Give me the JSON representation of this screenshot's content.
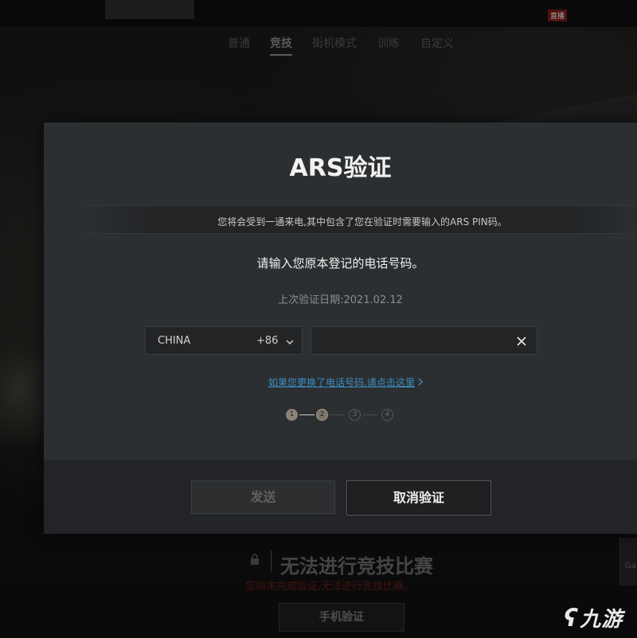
{
  "background": {
    "top_nav": {
      "live_badge": "直播"
    },
    "sub_nav": {
      "tabs": [
        {
          "label": "普通",
          "active": false
        },
        {
          "label": "竞技",
          "active": true
        },
        {
          "label": "街机模式",
          "active": false
        },
        {
          "label": "训练",
          "active": false
        },
        {
          "label": "自定义",
          "active": false
        }
      ]
    },
    "bottom": {
      "lock_icon": "lock-icon",
      "title": "无法进行竞技比赛",
      "subtitle": "您尚未完成验证,无法进行竞技比赛。",
      "phone_verify_label": "手机验证",
      "side_panel_text": "Ga"
    },
    "watermark": "九游"
  },
  "modal": {
    "title": "ARS验证",
    "notice": "您将会受到一通来电,其中包含了您在验证时需要输入的ARS PIN码。",
    "prompt": "请输入您原本登记的电话号码。",
    "last_verification": "上次验证日期:2021.02.12",
    "country": {
      "name": "CHINA",
      "code": "+86",
      "icon": "chevron-down-icon"
    },
    "phone_input": {
      "value": "",
      "placeholder": "",
      "clear_icon": "close-icon"
    },
    "change_link": "如果您更换了电话号码,请点击这里",
    "steps": {
      "current": 2,
      "labels": [
        "1",
        "2",
        "3",
        "4"
      ]
    },
    "buttons": {
      "send": "发送",
      "cancel": "取消验证"
    }
  },
  "colors": {
    "modal_bg": "#2c2f31",
    "footer_bg": "#222427",
    "link": "#3a8fc4",
    "warning": "#6b1d1a"
  }
}
